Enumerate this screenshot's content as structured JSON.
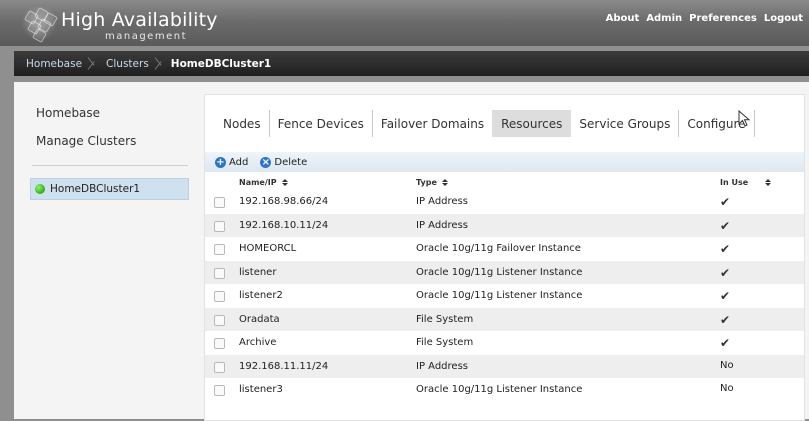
{
  "header": {
    "title": "High Availability",
    "subtitle": "management",
    "nav": [
      "About",
      "Admin",
      "Preferences",
      "Logout"
    ]
  },
  "breadcrumb": [
    "Homebase",
    "Clusters",
    "HomeDBCluster1"
  ],
  "sidebar": {
    "links": [
      "Homebase",
      "Manage Clusters"
    ],
    "cluster": {
      "label": "HomeDBCluster1",
      "status_color": "#2fae16"
    }
  },
  "tabs": [
    "Nodes",
    "Fence Devices",
    "Failover Domains",
    "Resources",
    "Service Groups",
    "Configure"
  ],
  "active_tab": "Resources",
  "toolbar": {
    "add_label": "Add",
    "delete_label": "Delete"
  },
  "table": {
    "headers": {
      "name": "Name/IP",
      "type": "Type",
      "in_use": "In Use"
    },
    "rows": [
      {
        "name": "192.168.98.66/24",
        "type": "IP Address",
        "in_use": "✔"
      },
      {
        "name": "192.168.10.11/24",
        "type": "IP Address",
        "in_use": "✔"
      },
      {
        "name": "HOMEORCL",
        "type": "Oracle 10g/11g Failover Instance",
        "in_use": "✔"
      },
      {
        "name": "listener",
        "type": "Oracle 10g/11g Listener Instance",
        "in_use": "✔"
      },
      {
        "name": "listener2",
        "type": "Oracle 10g/11g Listener Instance",
        "in_use": "✔"
      },
      {
        "name": "Oradata",
        "type": "File System",
        "in_use": "✔"
      },
      {
        "name": "Archive",
        "type": "File System",
        "in_use": "✔"
      },
      {
        "name": "192.168.11.11/24",
        "type": "IP Address",
        "in_use": "No"
      },
      {
        "name": "listener3",
        "type": "Oracle 10g/11g Listener Instance",
        "in_use": "No"
      }
    ]
  },
  "colors": {
    "accent": "#2f74c7",
    "active_tab_bg": "#dddddd",
    "toolbar_bg": "#dde8f2"
  }
}
